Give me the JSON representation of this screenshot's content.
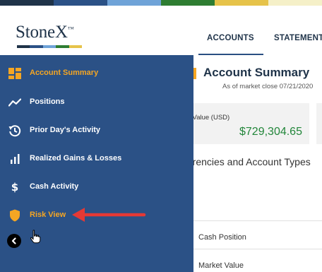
{
  "colors": {
    "sidebar_bg": "#2b5186",
    "accent": "#f5a623",
    "brand_dark": "#1f3349",
    "positive": "#22863a",
    "annotation_arrow": "#e53935"
  },
  "header": {
    "logo": "StoneX",
    "logo_mark": "™",
    "nav": [
      "ACCOUNTS",
      "STATEMENT"
    ]
  },
  "main": {
    "title": "Account Summary",
    "as_of": "As of market close 07/21/2020",
    "market_value_label": "et Value (USD)",
    "market_value": "$729,304.65",
    "section_title": "rrencies and Account Types",
    "rows": [
      "Cash Position",
      "Market Value"
    ]
  },
  "sidebar": {
    "items": [
      {
        "label": "Account Summary",
        "icon": "dashboard-icon",
        "active": true
      },
      {
        "label": "Positions",
        "icon": "trend-line-icon",
        "active": false
      },
      {
        "label": "Prior Day's Activity",
        "icon": "history-icon",
        "active": false
      },
      {
        "label": "Realized Gains & Losses",
        "icon": "bar-chart-icon",
        "active": false
      },
      {
        "label": "Cash Activity",
        "icon": "dollar-icon",
        "active": false
      },
      {
        "label": "Risk View",
        "icon": "shield-icon",
        "active": true
      }
    ],
    "collapse_icon": "chevron-left-icon"
  }
}
